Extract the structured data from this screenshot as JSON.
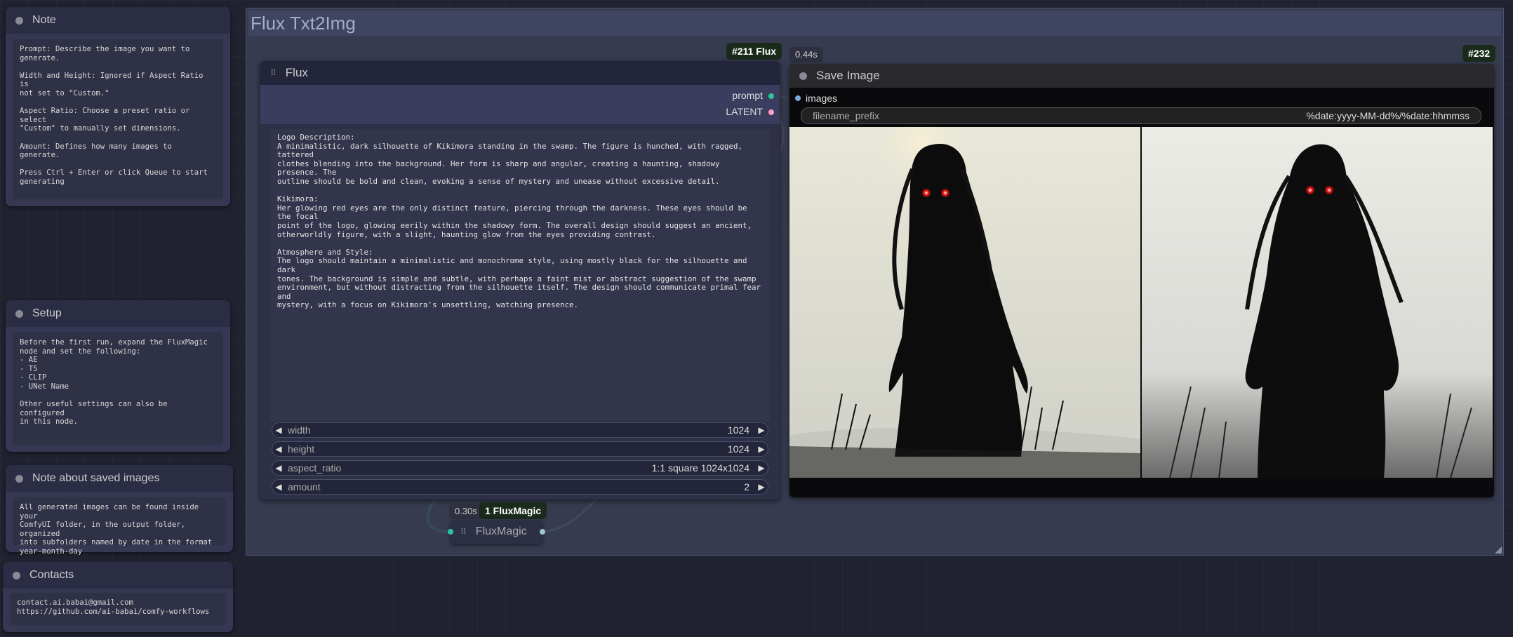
{
  "notes": {
    "note": {
      "title": "Note",
      "body": "Prompt: Describe the image you want to\ngenerate.\n\nWidth and Height: Ignored if Aspect Ratio is\nnot set to \"Custom.\"\n\nAspect Ratio: Choose a preset ratio or select\n\"Custom\" to manually set dimensions.\n\nAmount: Defines how many images to generate.\n\nPress Ctrl + Enter or click Queue to start\ngenerating"
    },
    "setup": {
      "title": "Setup",
      "body": "Before the first run, expand the FluxMagic\nnode and set the following:\n- AE\n- T5\n- CLIP\n- UNet Name\n\nOther useful settings can also be configured\nin this node."
    },
    "saved": {
      "title": "Note about saved images",
      "body": "All generated images can be found inside your\nComfyUI folder, in the output folder, organized\ninto subfolders named by date in the format\nyear-month-day"
    },
    "contacts": {
      "title": "Contacts",
      "body": "contact.ai.babai@gmail.com\nhttps://github.com/ai-babai/comfy-workflows"
    }
  },
  "group": {
    "title": "Flux Txt2Img"
  },
  "flux_node": {
    "badge": "#211 Flux",
    "title": "Flux",
    "outputs": [
      "prompt",
      "LATENT"
    ],
    "prompt_text": "Logo Description:\nA minimalistic, dark silhouette of Kikimora standing in the swamp. The figure is hunched, with ragged, tattered\nclothes blending into the background. Her form is sharp and angular, creating a haunting, shadowy presence. The\noutline should be bold and clean, evoking a sense of mystery and unease without excessive detail.\n\nKikimora:\nHer glowing red eyes are the only distinct feature, piercing through the darkness. These eyes should be the focal\npoint of the logo, glowing eerily within the shadowy form. The overall design should suggest an ancient,\notherworldly figure, with a slight, haunting glow from the eyes providing contrast.\n\nAtmosphere and Style:\nThe logo should maintain a minimalistic and monochrome style, using mostly black for the silhouette and dark\ntones. The background is simple and subtle, with perhaps a faint mist or abstract suggestion of the swamp\nenvironment, but without distracting from the silhouette itself. The design should communicate primal fear and\nmystery, with a focus on Kikimora's unsettling, watching presence.",
    "widgets": [
      {
        "label": "width",
        "value": "1024"
      },
      {
        "label": "height",
        "value": "1024"
      },
      {
        "label": "aspect_ratio",
        "value": "1:1 square 1024x1024"
      },
      {
        "label": "amount",
        "value": "2"
      }
    ]
  },
  "save_node": {
    "time": "0.44s",
    "badge": "#232",
    "title": "Save Image",
    "input": "images",
    "filename_label": "filename_prefix",
    "filename_value": "%date:yyyy-MM-dd%/%date:hhmmss"
  },
  "magic_node": {
    "time": "0.30s",
    "badge": "1 FluxMagic",
    "title": "FluxMagic"
  },
  "colors": {
    "red_eye": "#ff2020",
    "prompt_link": "#2ec4a0",
    "latent_link": "#ff9ccc"
  }
}
